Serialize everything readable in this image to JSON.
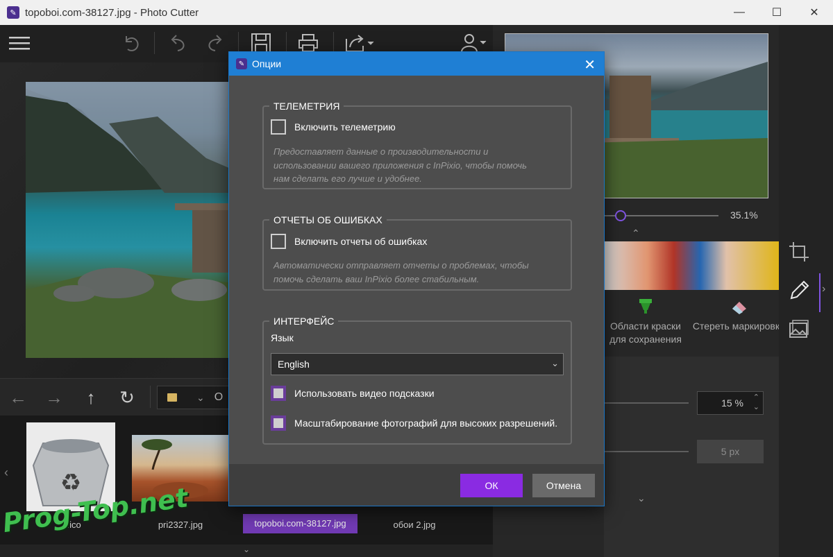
{
  "window": {
    "title": "topoboi.com-38127.jpg - Photo Cutter",
    "min_glyph": "—",
    "max_glyph": "☐",
    "close_glyph": "✕"
  },
  "toolbar": {
    "icons": [
      "menu-icon",
      "undo-all-icon",
      "undo-icon",
      "redo-icon",
      "save-icon",
      "print-icon",
      "share-icon",
      "user-icon"
    ]
  },
  "navigation": {
    "back": "←",
    "forward": "→",
    "up": "↑",
    "refresh": "↻",
    "path_chevron": "⌄",
    "path_text": "O"
  },
  "thumbnails": [
    {
      "label": "5.ico",
      "active": false
    },
    {
      "label": "pri2327.jpg",
      "active": false
    },
    {
      "label": "topoboi.com-38127.jpg",
      "active": true
    },
    {
      "label": "обои 2.jpg",
      "active": false
    }
  ],
  "thumb_nav": {
    "left": "‹",
    "down": "⌄"
  },
  "right_panel": {
    "zoom_value": "35.1%",
    "zoom_level": 0.1,
    "chev_up": "⌃",
    "chev_down": "⌄",
    "tool_keep": "Области краски\nдля сохранения",
    "tool_keep_line1": "Области краски",
    "tool_keep_line2": "для сохранения",
    "tool_erase": "Стереть маркировку",
    "opacity_value": "15 %",
    "brush_value": "5 px",
    "spin_up": "⌃",
    "spin_down": "⌄"
  },
  "side_tools": [
    "crop-icon",
    "pen-icon",
    "image-icon"
  ],
  "side_chevron": "›",
  "dialog": {
    "title": "Опции",
    "close": "✕",
    "telemetry": {
      "legend": "ТЕЛЕМЕТРИЯ",
      "checkbox_label": "Включить телеметрию",
      "description": "Предоставляет данные о производительности и использовании вашего приложения с InPixio, чтобы помочь нам сделать его лучше и удобнее.",
      "desc_line1": "Предоставляет данные о производительности и",
      "desc_line2": "использовании вашего приложения с InPixio, чтобы помочь",
      "desc_line3": "нам сделать его лучше и удобнее."
    },
    "errors": {
      "legend": "ОТЧЕТЫ ОБ ОШИБКАХ",
      "checkbox_label": "Включить отчеты об ошибках",
      "desc_line1": "Автоматически отправляет отчеты о проблемах, чтобы",
      "desc_line2": "помочь сделать ваш InPixio более стабильным."
    },
    "interface": {
      "legend": "ИНТЕРФЕЙС",
      "language_label": "Язык",
      "language_value": "English",
      "caret": "⌄",
      "video_hints_label": "Использовать видео подсказки",
      "hidpi_label": "Масштабирование фотографий для высоких разрешений."
    },
    "ok_label": "ОК",
    "cancel_label": "Отмена"
  },
  "watermark": "Prog-Top.net",
  "colors": {
    "accent": "#8a2be2",
    "dialog_title": "#1f7fd4",
    "checkbox_purple": "#6a3d9a"
  }
}
